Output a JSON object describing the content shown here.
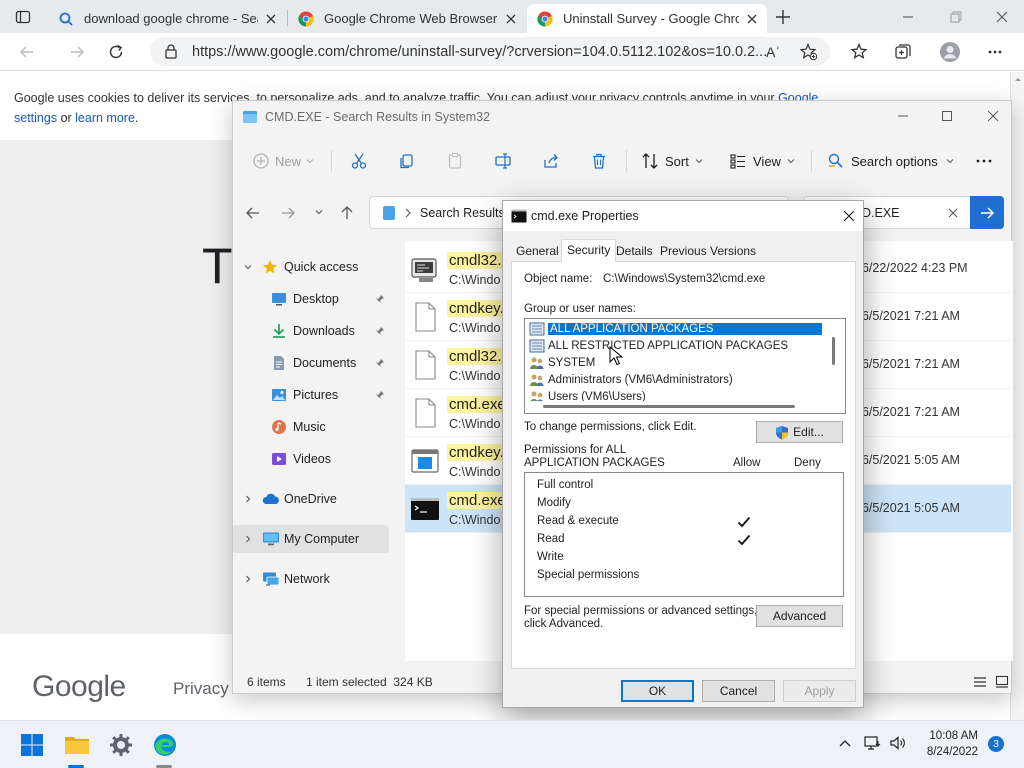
{
  "browser": {
    "tabs": [
      {
        "title": "download google chrome - Sear",
        "icon": "search-icon",
        "active": false
      },
      {
        "title": "Google Chrome Web Browser",
        "icon": "chrome-icon",
        "active": false
      },
      {
        "title": "Uninstall Survey - Google Chrom",
        "icon": "chrome-icon",
        "active": true
      }
    ],
    "url": "https://www.google.com/chrome/uninstall-survey/?crversion=104.0.5112.102&os=10.0.2...",
    "read_aloud_glyph": "Aʾ"
  },
  "page": {
    "cookie_text_1": "Google uses cookies to deliver its services, to personalize ads, and to analyze traffic. You can adjust your privacy controls anytime in your ",
    "cookie_link_1": "Google",
    "cookie_link_2": "settings",
    "cookie_text_2": " or ",
    "cookie_link_3": "learn more",
    "cookie_text_3": ".",
    "big_letter": "Th",
    "logo": "Google",
    "footer_link": "Privacy"
  },
  "explorer": {
    "title": "CMD.EXE - Search Results in System32",
    "commands": {
      "new": "New",
      "sort": "Sort",
      "view": "View",
      "search_options": "Search options"
    },
    "path": "Search Results in",
    "search_value": "D.EXE",
    "nav": {
      "quick_access": "Quick access",
      "desktop": "Desktop",
      "downloads": "Downloads",
      "documents": "Documents",
      "pictures": "Pictures",
      "music": "Music",
      "videos": "Videos",
      "onedrive": "OneDrive",
      "my_computer": "My Computer",
      "network": "Network"
    },
    "files": [
      {
        "name": "cmdl32.",
        "path": "C:\\Windo",
        "date": ": 6/22/2022 4:23 PM",
        "icon": "cmdl32-exe-icon"
      },
      {
        "name": "cmdkey.",
        "path": "C:\\Windo",
        "date": ": 6/5/2021 7:21 AM",
        "icon": "file-icon"
      },
      {
        "name": "cmdl32.",
        "path": "C:\\Windo",
        "date": ": 6/5/2021 7:21 AM",
        "icon": "file-icon"
      },
      {
        "name": "cmd.exe",
        "path": "C:\\Windo",
        "date": ": 6/5/2021 7:21 AM",
        "icon": "file-icon"
      },
      {
        "name": "cmdkey.",
        "path": "C:\\Windo",
        "date": ": 6/5/2021 5:05 AM",
        "icon": "app-window-icon"
      },
      {
        "name": "cmd.exe",
        "path": "C:\\Windo",
        "date": ": 6/5/2021 5:05 AM",
        "icon": "cmd-exe-icon"
      }
    ],
    "status": {
      "items": "6 items",
      "selected": "1 item selected  324 KB"
    }
  },
  "dialog": {
    "title": "cmd.exe Properties",
    "tabs": [
      "General",
      "Security",
      "Details",
      "Previous Versions"
    ],
    "active_tab": "Security",
    "object_name_label": "Object name:",
    "object_name_value": "C:\\Windows\\System32\\cmd.exe",
    "group_label": "Group or user names:",
    "groups": [
      {
        "name": "ALL APPLICATION PACKAGES",
        "selected": true
      },
      {
        "name": "ALL RESTRICTED APPLICATION PACKAGES",
        "selected": false
      },
      {
        "name": "SYSTEM",
        "selected": false
      },
      {
        "name": "Administrators (VM6\\Administrators)",
        "selected": false
      },
      {
        "name": "Users (VM6\\Users)",
        "selected": false
      }
    ],
    "change_text": "To change permissions, click Edit.",
    "edit_button": "Edit...",
    "perm_label_1": "Permissions for ALL",
    "perm_label_2": "APPLICATION PACKAGES",
    "allow": "Allow",
    "deny": "Deny",
    "permissions": [
      {
        "name": "Full control",
        "allow": false
      },
      {
        "name": "Modify",
        "allow": false
      },
      {
        "name": "Read & execute",
        "allow": true
      },
      {
        "name": "Read",
        "allow": true
      },
      {
        "name": "Write",
        "allow": false
      },
      {
        "name": "Special permissions",
        "allow": false
      }
    ],
    "special_text_1": "For special permissions or advanced settings,",
    "special_text_2": "click Advanced.",
    "advanced_button": "Advanced",
    "ok": "OK",
    "cancel": "Cancel",
    "apply": "Apply"
  },
  "taskbar": {
    "time": "10:08 AM",
    "date": "8/24/2022",
    "notification_count": "3"
  },
  "colors": {
    "accent": "#0078d7",
    "selection": "#cce4f7",
    "highlight": "#fff59d"
  }
}
